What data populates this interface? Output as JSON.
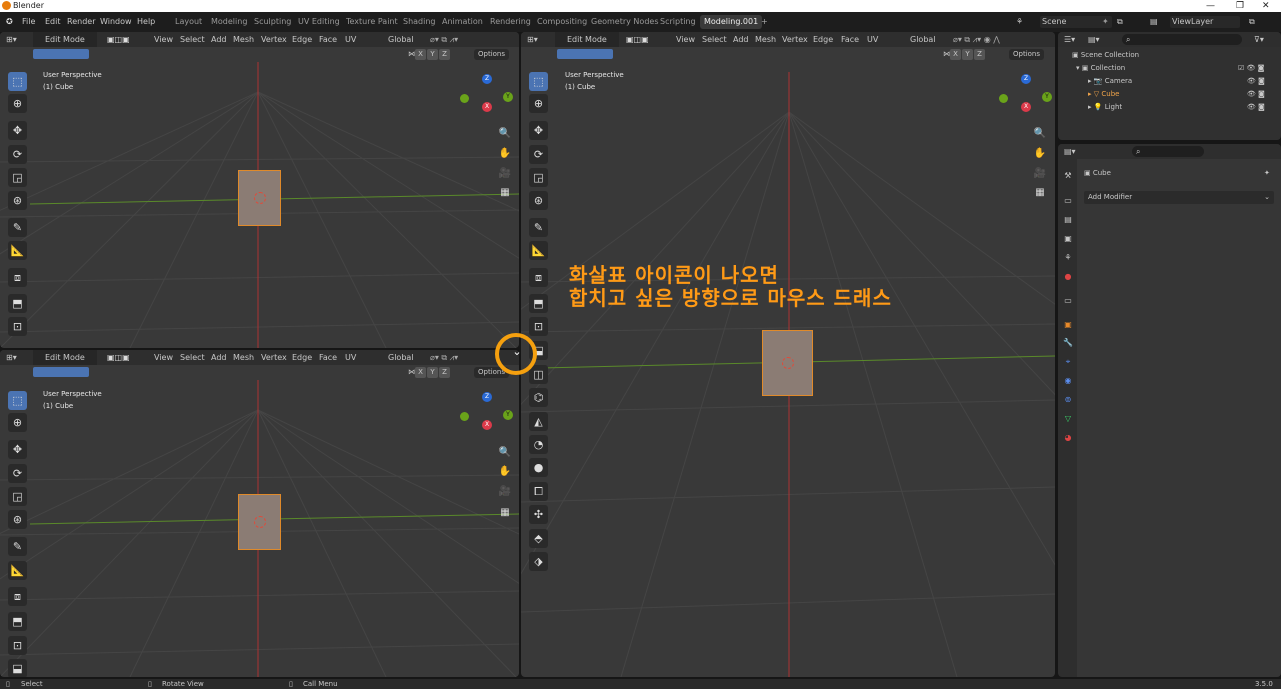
{
  "window": {
    "title": "Blender",
    "minimize": "—",
    "maximize": "❐",
    "close": "✕"
  },
  "topbar": {
    "menus": [
      "File",
      "Edit",
      "Render",
      "Window",
      "Help"
    ],
    "workspaces": [
      "Layout",
      "Modeling",
      "Sculpting",
      "UV Editing",
      "Texture Paint",
      "Shading",
      "Animation",
      "Rendering",
      "Compositing",
      "Geometry Nodes",
      "Scripting",
      "Modeling.001"
    ],
    "add_tab": "+",
    "scene": "Scene",
    "view_layer": "ViewLayer"
  },
  "viewport": {
    "mode": "Edit Mode",
    "menus": [
      "View",
      "Select",
      "Add",
      "Mesh",
      "Vertex",
      "Edge",
      "Face",
      "UV"
    ],
    "orientation": "Global",
    "options": "Options",
    "axis_x": "X",
    "axis_y": "Y",
    "axis_z": "Z",
    "overlay_line1": "User Perspective",
    "overlay_line2": "(1) Cube",
    "gizmo_z": "Z",
    "gizmo_y": "Y",
    "gizmo_x": "X"
  },
  "annotation": {
    "line1": "화살표 아이콘이 나오면",
    "line2": "합치고 싶은 방향으로 마우스 드래스",
    "accent": "#ff9a16"
  },
  "outliner": {
    "header": "Scene Collection",
    "items": [
      "Collection",
      "Camera",
      "Cube",
      "Light"
    ]
  },
  "properties": {
    "object_name": "Cube",
    "add_modifier": "Add Modifier"
  },
  "statusbar": {
    "select": "Select",
    "rotate": "Rotate View",
    "call_menu": "Call Menu",
    "version": "3.5.0"
  }
}
